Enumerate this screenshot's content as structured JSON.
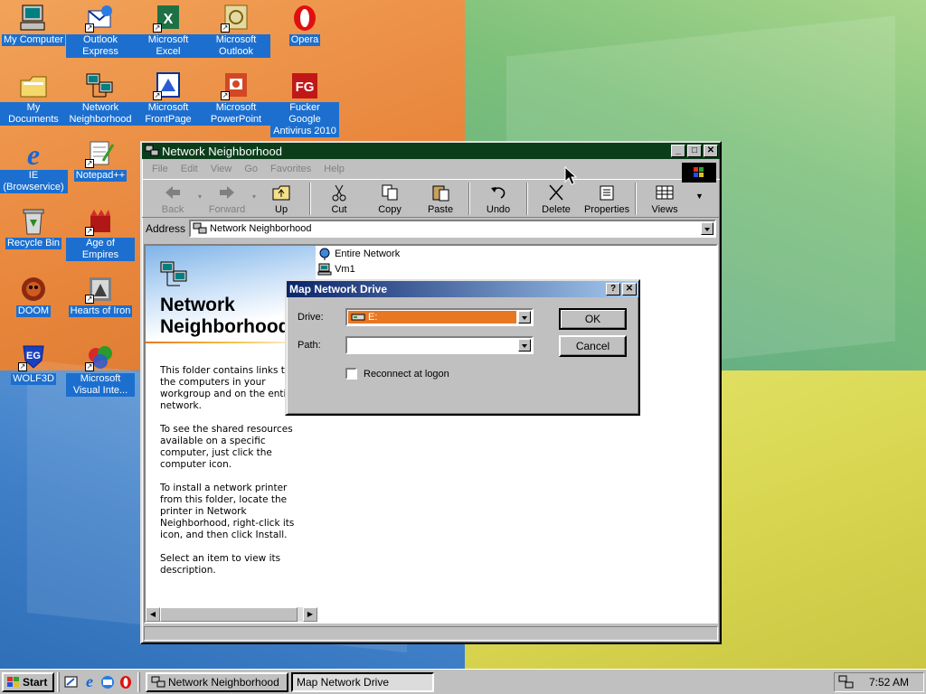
{
  "desktop_icons": [
    {
      "label": "My Computer",
      "icon": "computer-icon"
    },
    {
      "label": "Outlook Express",
      "icon": "outlook-express-icon"
    },
    {
      "label": "Microsoft Excel",
      "icon": "excel-icon"
    },
    {
      "label": "Microsoft Outlook",
      "icon": "outlook-icon"
    },
    {
      "label": "Opera",
      "icon": "opera-icon"
    },
    {
      "label": "My Documents",
      "icon": "folder-icon"
    },
    {
      "label": "Network Neighborhood",
      "icon": "network-icon"
    },
    {
      "label": "Microsoft FrontPage",
      "icon": "frontpage-icon"
    },
    {
      "label": "Microsoft PowerPoint",
      "icon": "powerpoint-icon"
    },
    {
      "label": "Fucker Google Antivirus 2010",
      "icon": "fg-antivirus-icon"
    },
    {
      "label": "IE (Browservice)",
      "icon": "ie-icon"
    },
    {
      "label": "Notepad++",
      "icon": "notepad-icon"
    },
    {
      "label": "Recycle Bin",
      "icon": "recycle-bin-icon"
    },
    {
      "label": "Age of Empires",
      "icon": "age-of-empires-icon"
    },
    {
      "label": "DOOM",
      "icon": "doom-icon"
    },
    {
      "label": "Hearts of Iron",
      "icon": "hearts-of-iron-icon"
    },
    {
      "label": "WOLF3D",
      "icon": "wolf3d-icon"
    },
    {
      "label": "Microsoft Visual Inte...",
      "icon": "visual-studio-icon"
    }
  ],
  "explorer": {
    "title": "Network Neighborhood",
    "menu": [
      "File",
      "Edit",
      "View",
      "Go",
      "Favorites",
      "Help"
    ],
    "toolbar": [
      {
        "label": "Back",
        "icon": "back-arrow-icon",
        "enabled": false
      },
      {
        "label": "Forward",
        "icon": "forward-arrow-icon",
        "enabled": false
      },
      {
        "label": "Up",
        "icon": "up-folder-icon",
        "enabled": true
      },
      {
        "label": "Cut",
        "icon": "scissors-icon",
        "enabled": true
      },
      {
        "label": "Copy",
        "icon": "copy-icon",
        "enabled": true
      },
      {
        "label": "Paste",
        "icon": "paste-icon",
        "enabled": true
      },
      {
        "label": "Undo",
        "icon": "undo-icon",
        "enabled": true
      },
      {
        "label": "Delete",
        "icon": "delete-x-icon",
        "enabled": true
      },
      {
        "label": "Properties",
        "icon": "properties-icon",
        "enabled": true
      },
      {
        "label": "Views",
        "icon": "views-icon",
        "enabled": true
      }
    ],
    "address_label": "Address",
    "address_value": "Network Neighborhood",
    "webview_title": "Network Neighborhood",
    "webview_paragraphs": [
      "This folder contains links to all the computers in your workgroup and on the entire network.",
      "To see the shared resources available on a specific computer, just click the computer icon.",
      "To install a network printer from this folder, locate the printer in Network Neighborhood, right-click its icon, and then click Install.",
      "Select an item to view its description."
    ],
    "items": [
      {
        "label": "Entire Network",
        "icon": "globe-network-icon"
      },
      {
        "label": "Vm1",
        "icon": "computer-icon"
      }
    ]
  },
  "dialog": {
    "title": "Map Network Drive",
    "drive_label": "Drive:",
    "drive_value": "E:",
    "path_label": "Path:",
    "path_value": "",
    "reconnect_label": "Reconnect at logon",
    "reconnect_checked": false,
    "ok_label": "OK",
    "cancel_label": "Cancel"
  },
  "taskbar": {
    "start_label": "Start",
    "tasks": [
      {
        "label": "Network Neighborhood",
        "active": false
      },
      {
        "label": "Map Network Drive",
        "active": true
      }
    ],
    "clock": "7:52 AM"
  },
  "colors": {
    "selection": "#e87722",
    "desktop_label_bg": "#1c6fcf",
    "dialog_title": "#0a246a"
  }
}
